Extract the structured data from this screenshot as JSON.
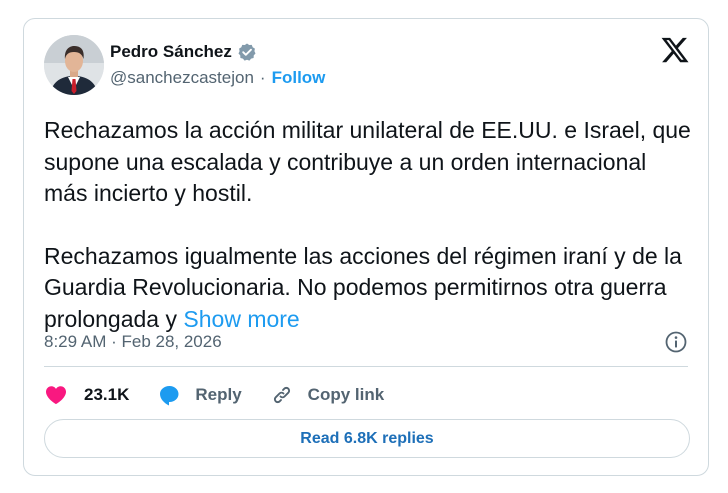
{
  "author": {
    "name": "Pedro Sánchez",
    "handle": "@sanchezcastejon",
    "follow_label": "Follow",
    "verified": true,
    "avatar": "profile-photo"
  },
  "tweet": {
    "paragraph1": "Rechazamos la acción militar unilateral de EE.UU. e Israel, que supone una escalada y contribuye a un orden internacional más incierto y hostil.",
    "paragraph2": "Rechazamos igualmente las acciones del régimen iraní y de la Guardia Revolucionaria. No podemos permitirnos otra guerra prolongada y ",
    "show_more_label": "Show more",
    "timestamp": "8:29 AM · Feb 28, 2026"
  },
  "actions": {
    "like_count": "23.1K",
    "reply_label": "Reply",
    "copy_link_label": "Copy link"
  },
  "replies_button": "Read 6.8K replies",
  "colors": {
    "accent": "#1d9bf0",
    "like": "#f91880",
    "reply_icon": "#1d9bf0",
    "verified_badge": "#829aab",
    "text": "#0f1419",
    "muted": "#536471",
    "border": "#cfd9de"
  },
  "icons": {
    "brand": "x-logo-icon",
    "verified": "verified-badge-icon",
    "info": "info-icon",
    "like": "heart-icon",
    "reply": "speech-bubble-icon",
    "copy_link": "link-icon"
  }
}
